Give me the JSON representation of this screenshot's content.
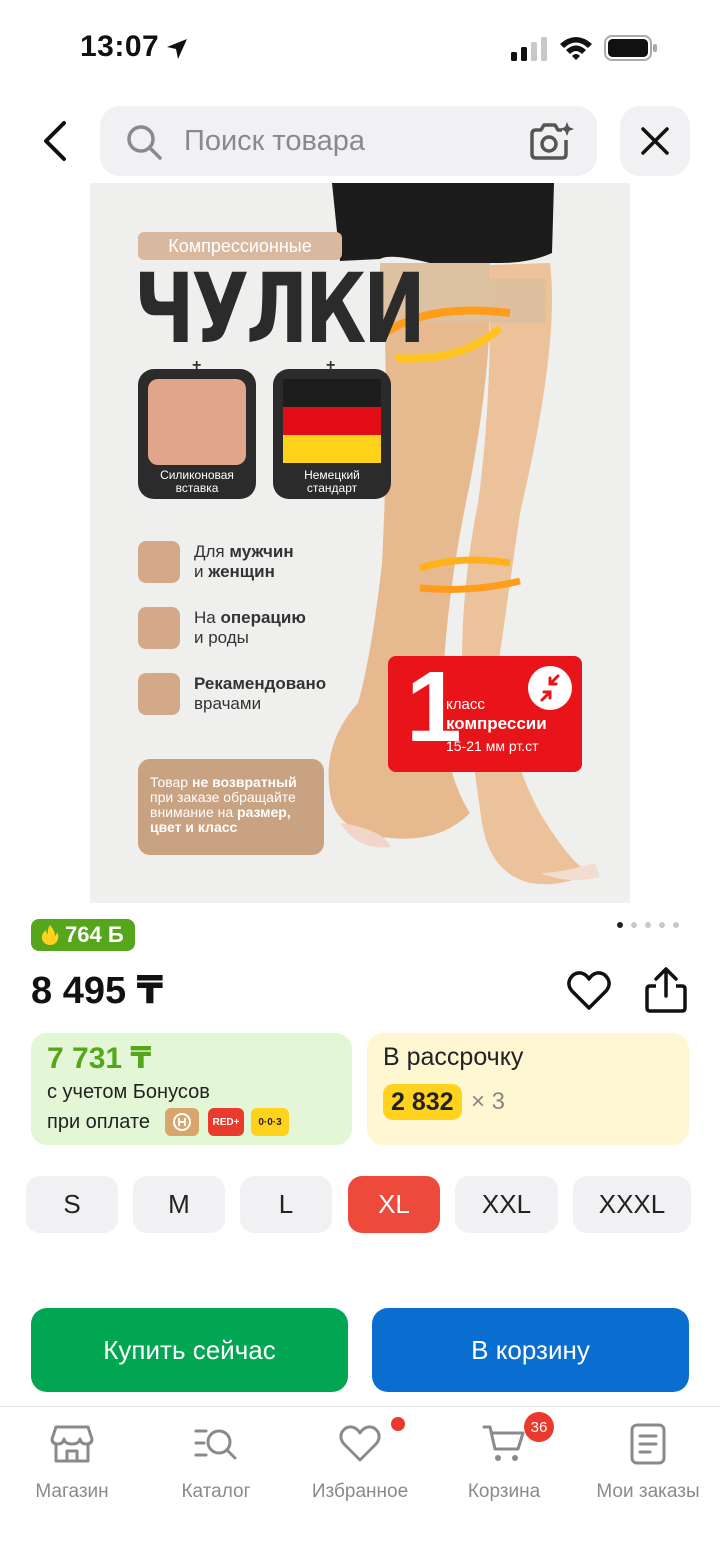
{
  "status_bar": {
    "time": "13:07"
  },
  "search": {
    "placeholder": "Поиск товара"
  },
  "product_image": {
    "badge_top": "Компрессионные",
    "title": "ЧУЛКИ",
    "card1_label_line1": "Силиконовая",
    "card1_label_line2": "вставка",
    "card2_label_line1": "Немецкий",
    "card2_label_line2": "стандарт",
    "feature1_pre": "Для ",
    "feature1_bold": "мужчин",
    "feature1_line2_pre": "и ",
    "feature1_line2_bold": "женщин",
    "feature2_pre": "На ",
    "feature2_bold": "операцию",
    "feature2_line2": "и роды",
    "feature3_bold": "Рекамендовано",
    "feature3_line2": "врачами",
    "note_text_pre": "Товар ",
    "note_text_bold": "не возвратный",
    "note_text_mid": " при заказе обращайте внимание на ",
    "note_text_bold2": "размер, цвет и класс",
    "red_badge_number": "1",
    "red_badge_line1": "класс",
    "red_badge_line2": "компрессии",
    "red_badge_line3": "15-21 мм рт.ст"
  },
  "bonus_badge": {
    "value": "764 Б"
  },
  "price": "8 495 ₸",
  "bonus_card": {
    "price": "7 731 ₸",
    "line1": "с учетом Бонусов",
    "line2": "при оплате",
    "chips": [
      "RED+",
      "0·0·3"
    ]
  },
  "installment": {
    "title": "В рассрочку",
    "amount": "2 832",
    "multiplier": "× 3"
  },
  "sizes": [
    "S",
    "M",
    "L",
    "XL",
    "XXL",
    "XXXL"
  ],
  "selected_size": "XL",
  "actions": {
    "buy_now": "Купить сейчас",
    "add_to_cart": "В корзину"
  },
  "tab_bar": {
    "items": [
      {
        "label": "Магазин",
        "icon": "store-icon"
      },
      {
        "label": "Каталог",
        "icon": "catalog-search-icon"
      },
      {
        "label": "Избранное",
        "icon": "heart-icon"
      },
      {
        "label": "Корзина",
        "icon": "cart-icon"
      },
      {
        "label": "Мои заказы",
        "icon": "orders-icon"
      }
    ],
    "cart_count": "36"
  },
  "colors": {
    "bonus_green": "#56a61b",
    "selected_size": "#ee4a3c",
    "buy_green": "#00a651",
    "cart_blue": "#0a6ed1",
    "installment_yellow": "#ffd21d",
    "badge_red": "#e93a2d"
  }
}
